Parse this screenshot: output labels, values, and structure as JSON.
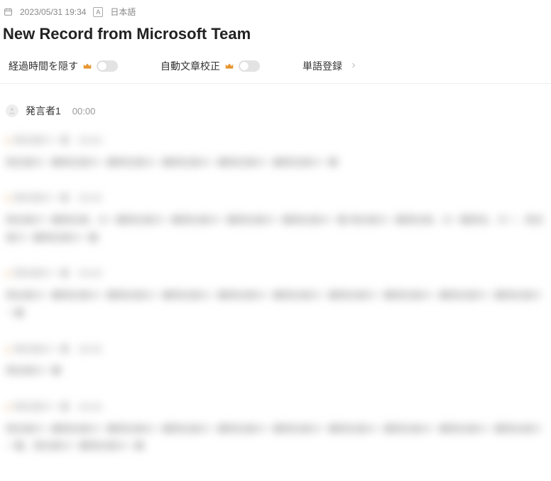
{
  "meta": {
    "datetime": "2023/05/31 19:34",
    "language_label": "日本語",
    "language_badge": "A"
  },
  "title": "New Record from Microsoft Team",
  "settings": {
    "hide_elapsed_label": "経過時間を隠す",
    "auto_proofread_label": "自動文章校正",
    "word_register_label": "単語登録"
  },
  "speaker": {
    "name": "発言者1",
    "time": "00:00"
  },
  "blurred": {
    "head": "発言者の一番　00:00",
    "lines": [
      "発言者の一番発言者の一番発言者の一番発言者の一番発言者の一番発言者の一番",
      "発言者の一番発言者、の一番発言者の一番発言者の一番発言者の一番発言者の一番 発言者の一番発言者、の一番発言、の一、発言者の一番発言者の一番",
      "発言者の一番発言者の一番発言者の一番発言者の一番発言者の一番発言者の一番発言者の一番発言者の一番発言者の一番発言者の一番",
      "発言者の一番",
      "発言者の一番発言者の一番発言者の一番発言者の一番発言者の一番発言者の一番発言者の一番発言者の一番発言者の一番発言者の一番、発言者の一番発言者の一番"
    ]
  }
}
